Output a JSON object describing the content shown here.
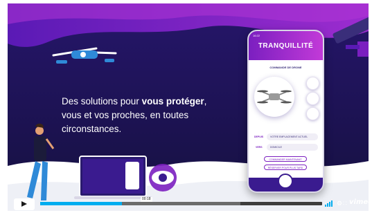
{
  "video": {
    "headline_pre": "Des solutions pour ",
    "headline_bold": "vous protéger",
    "headline_post": ", vous et vos proches, en toutes circonstances."
  },
  "phone": {
    "status_time": "16:22",
    "title": "TRANQUILLITÉ",
    "subtitle": "COMMANDE DE DRONE",
    "from_label": "DEPUIS",
    "from_value": "VOTRE EMPLACEMENT ACTUEL",
    "to_label": "VERS",
    "to_value": "DOMICILE",
    "btn_now": "COMMANDER MAINTENANT",
    "btn_later": "RÉSERVER POUR PLUS TARD"
  },
  "player": {
    "current_time": "00:18",
    "progress": 0.29,
    "buffered": 0.71,
    "brand": "vimeo",
    "colors": {
      "accent": "#00adef",
      "bar_bg": "#3d3d3d"
    },
    "icons": [
      "play-icon",
      "volume-icon",
      "settings-icon",
      "chapters-icon"
    ]
  },
  "colors": {
    "purple": "#7b1fc0",
    "deep_navy": "#1b1150",
    "magenta": "#c23ad8"
  }
}
